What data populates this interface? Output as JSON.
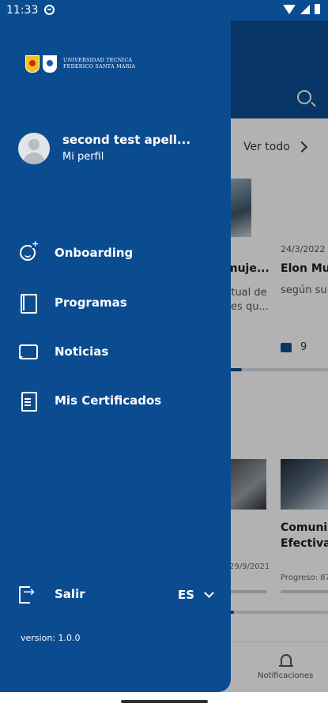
{
  "status_bar": {
    "time": "11:33"
  },
  "drawer": {
    "logo_line1": "UNIVERSIDAD TECNICA",
    "logo_line2": "FEDERICO SANTA MARIA",
    "user_name": "second test apell...",
    "profile_link": "Mi perfil",
    "menu": [
      {
        "label": "Onboarding",
        "icon": "onboarding-icon"
      },
      {
        "label": "Programas",
        "icon": "book-icon"
      },
      {
        "label": "Noticias",
        "icon": "chat-icon"
      },
      {
        "label": "Mis Certificados",
        "icon": "document-icon"
      }
    ],
    "logout_label": "Salir",
    "language": "ES",
    "version": "version: 1.0.0"
  },
  "background": {
    "see_all": "Ver todo",
    "card1_title": "muje...",
    "card1_desc": "rtual de res qu...",
    "card2_date": "24/3/2022",
    "card2_title": "Elon Mus",
    "card2_desc": "según su",
    "card2_likes": "9",
    "card3_title_line1": "Comuni",
    "card3_title_line2": "Efectiva",
    "card4_date": "29/9/2021",
    "progress_label": "Progreso: 87",
    "nav_notifications": "Notificaciones"
  },
  "colors": {
    "primary": "#0b4c91",
    "drawer_text": "#ffffff"
  }
}
